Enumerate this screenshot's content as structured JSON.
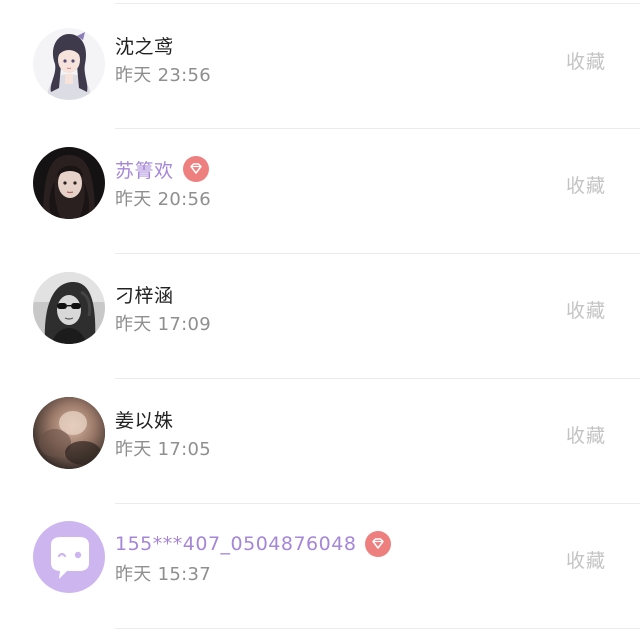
{
  "contacts": [
    {
      "name": "沈之鸢",
      "time": "昨天 23:56",
      "action": "收藏",
      "vip": false,
      "avatar": "anime-girl-avatar"
    },
    {
      "name": "苏箐欢",
      "time": "昨天 20:56",
      "action": "收藏",
      "vip": true,
      "avatar": "dark-hair-woman-avatar"
    },
    {
      "name": "刁梓涵",
      "time": "昨天 17:09",
      "action": "收藏",
      "vip": false,
      "avatar": "sunglasses-woman-avatar"
    },
    {
      "name": "姜以姝",
      "time": "昨天 17:05",
      "action": "收藏",
      "vip": false,
      "avatar": "blurred-photo-avatar"
    },
    {
      "name": "155***407_0504876048",
      "time": "昨天 15:37",
      "action": "收藏",
      "vip": true,
      "avatar": "default-chat-bubble-avatar"
    }
  ],
  "colors": {
    "vip_name": "#a586d8",
    "vip_badge": "#ee7f7f",
    "time_text": "#8f8f8f",
    "action_text": "#c4c4c4",
    "default_avatar_bg": "#cdb6f0"
  },
  "icons": {
    "vip_badge": "diamond-icon"
  }
}
